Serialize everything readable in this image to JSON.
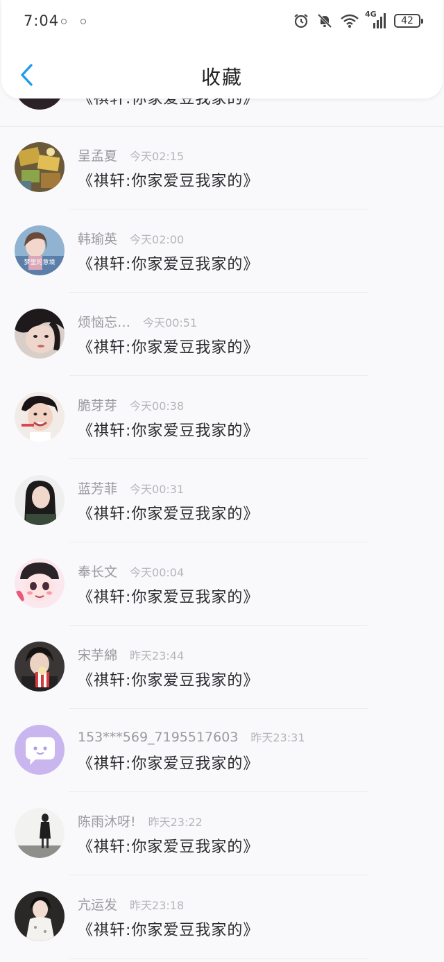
{
  "status_bar": {
    "time": "7:04",
    "network": "4G",
    "battery": "42"
  },
  "nav": {
    "title": "收藏"
  },
  "message_text": "《祺轩:你家爱豆我家的》",
  "colors": {
    "accent_blue": "#1e9bf0",
    "name_gray": "#9a9aa0",
    "message_text": "#2a2a2e"
  },
  "items": [
    {
      "name": "",
      "time": "",
      "message": "《祺轩:你家爱豆我家的》",
      "avatar": "avatar-dark"
    },
    {
      "name": "呈孟夏",
      "time": "今天02:15",
      "message": "《祺轩:你家爱豆我家的》",
      "avatar": "avatar-gold-items"
    },
    {
      "name": "韩瑜英",
      "time": "今天02:00",
      "message": "《祺轩:你家爱豆我家的》",
      "avatar": "avatar-anime-girl",
      "avatar_caption": "梦里的意境"
    },
    {
      "name": "烦恼忘…",
      "time": "今天00:51",
      "message": "《祺轩:你家爱豆我家的》",
      "avatar": "avatar-girl-closeup"
    },
    {
      "name": "脆芽芽",
      "time": "今天00:38",
      "message": "《祺轩:你家爱豆我家的》",
      "avatar": "avatar-boy-smile"
    },
    {
      "name": "蓝芳菲",
      "time": "今天00:31",
      "message": "《祺轩:你家爱豆我家的》",
      "avatar": "avatar-woman-dark-hair"
    },
    {
      "name": "奉长文",
      "time": "今天00:04",
      "message": "《祺轩:你家爱豆我家的》",
      "avatar": "avatar-cartoon-cap"
    },
    {
      "name": "宋芋綿",
      "time": "昨天23:44",
      "message": "《祺轩:你家爱豆我家的》",
      "avatar": "avatar-boy-popcorn"
    },
    {
      "name": "153***569_7195517603",
      "time": "昨天23:31",
      "message": "《祺轩:你家爱豆我家的》",
      "avatar": "avatar-default-chat"
    },
    {
      "name": "陈雨沐呀!",
      "time": "昨天23:22",
      "message": "《祺轩:你家爱豆我家的》",
      "avatar": "avatar-standing-figure"
    },
    {
      "name": "亢运发",
      "time": "昨天23:18",
      "message": "《祺轩:你家爱豆我家的》",
      "avatar": "avatar-woman-white-dress"
    }
  ]
}
